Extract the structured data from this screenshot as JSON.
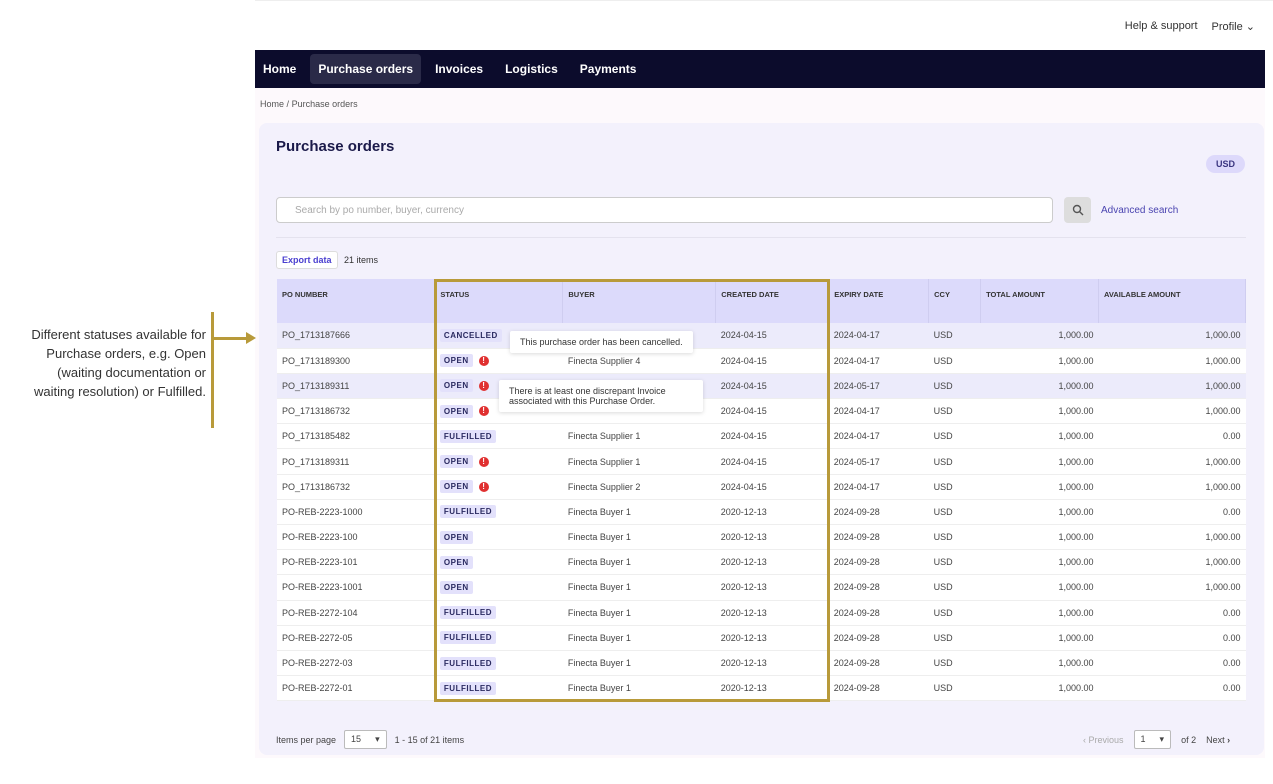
{
  "header": {
    "help": "Help & support",
    "profile": "Profile"
  },
  "nav": [
    "Home",
    "Purchase orders",
    "Invoices",
    "Logistics",
    "Payments"
  ],
  "breadcrumb": {
    "home": "Home",
    "sep": "/",
    "current": "Purchase orders"
  },
  "page": {
    "title": "Purchase orders",
    "currency_badge": "USD",
    "search_placeholder": "Search by po number, buyer, currency",
    "advanced_search": "Advanced search",
    "export": "Export data",
    "item_count": "21 items"
  },
  "table": {
    "columns": [
      "PO NUMBER",
      "STATUS",
      "BUYER",
      "CREATED DATE",
      "EXPIRY DATE",
      "CCY",
      "TOTAL AMOUNT",
      "AVAILABLE AMOUNT"
    ],
    "rows": [
      [
        "PO_1713187666",
        "CANCELLED",
        "",
        "2024-04-15",
        "2024-04-17",
        "USD",
        "1,000.00",
        "1,000.00"
      ],
      [
        "PO_1713189300",
        "OPEN",
        "Finecta Supplier 4",
        "2024-04-15",
        "2024-04-17",
        "USD",
        "1,000.00",
        "1,000.00"
      ],
      [
        "PO_1713189311",
        "OPEN",
        "",
        "2024-04-15",
        "2024-05-17",
        "USD",
        "1,000.00",
        "1,000.00"
      ],
      [
        "PO_1713186732",
        "OPEN",
        "",
        "2024-04-15",
        "2024-04-17",
        "USD",
        "1,000.00",
        "1,000.00"
      ],
      [
        "PO_1713185482",
        "FULFILLED",
        "Finecta Supplier 1",
        "2024-04-15",
        "2024-04-17",
        "USD",
        "1,000.00",
        "0.00"
      ],
      [
        "PO_1713189311",
        "OPEN",
        "Finecta Supplier 1",
        "2024-04-15",
        "2024-05-17",
        "USD",
        "1,000.00",
        "1,000.00"
      ],
      [
        "PO_1713186732",
        "OPEN",
        "Finecta Supplier 2",
        "2024-04-15",
        "2024-04-17",
        "USD",
        "1,000.00",
        "1,000.00"
      ],
      [
        "PO-REB-2223-1000",
        "FULFILLED",
        "Finecta Buyer 1",
        "2020-12-13",
        "2024-09-28",
        "USD",
        "1,000.00",
        "0.00"
      ],
      [
        "PO-REB-2223-100",
        "OPEN",
        "Finecta Buyer 1",
        "2020-12-13",
        "2024-09-28",
        "USD",
        "1,000.00",
        "1,000.00"
      ],
      [
        "PO-REB-2223-101",
        "OPEN",
        "Finecta Buyer 1",
        "2020-12-13",
        "2024-09-28",
        "USD",
        "1,000.00",
        "1,000.00"
      ],
      [
        "PO-REB-2223-1001",
        "OPEN",
        "Finecta Buyer 1",
        "2020-12-13",
        "2024-09-28",
        "USD",
        "1,000.00",
        "1,000.00"
      ],
      [
        "PO-REB-2272-104",
        "FULFILLED",
        "Finecta Buyer 1",
        "2020-12-13",
        "2024-09-28",
        "USD",
        "1,000.00",
        "0.00"
      ],
      [
        "PO-REB-2272-05",
        "FULFILLED",
        "Finecta Buyer 1",
        "2020-12-13",
        "2024-09-28",
        "USD",
        "1,000.00",
        "0.00"
      ],
      [
        "PO-REB-2272-03",
        "FULFILLED",
        "Finecta Buyer 1",
        "2020-12-13",
        "2024-09-28",
        "USD",
        "1,000.00",
        "0.00"
      ],
      [
        "PO-REB-2272-01",
        "FULFILLED",
        "Finecta Buyer 1",
        "2020-12-13",
        "2024-09-28",
        "USD",
        "1,000.00",
        "0.00"
      ]
    ],
    "warning_rows": [
      1,
      2,
      3,
      5,
      6
    ]
  },
  "tooltips": {
    "cancelled": "This purchase order has been cancelled.",
    "discrepant": "There is at least one discrepant Invoice associated with this Purchase Order."
  },
  "footer": {
    "items_per_page_label": "Items per page",
    "items_per_page": "15",
    "range": "1 - 15 of 21 items",
    "previous": "Previous",
    "page": "1",
    "of": "of 2",
    "next": "Next"
  },
  "annotation": "Different statuses available for Purchase orders, e.g. Open (waiting documentation or waiting resolution) or Fulfilled.",
  "colors": {
    "nav": "#0c0c2c",
    "accent": "#4a3fd0",
    "highlight": "#b89a3a",
    "warning": "#e03030"
  }
}
